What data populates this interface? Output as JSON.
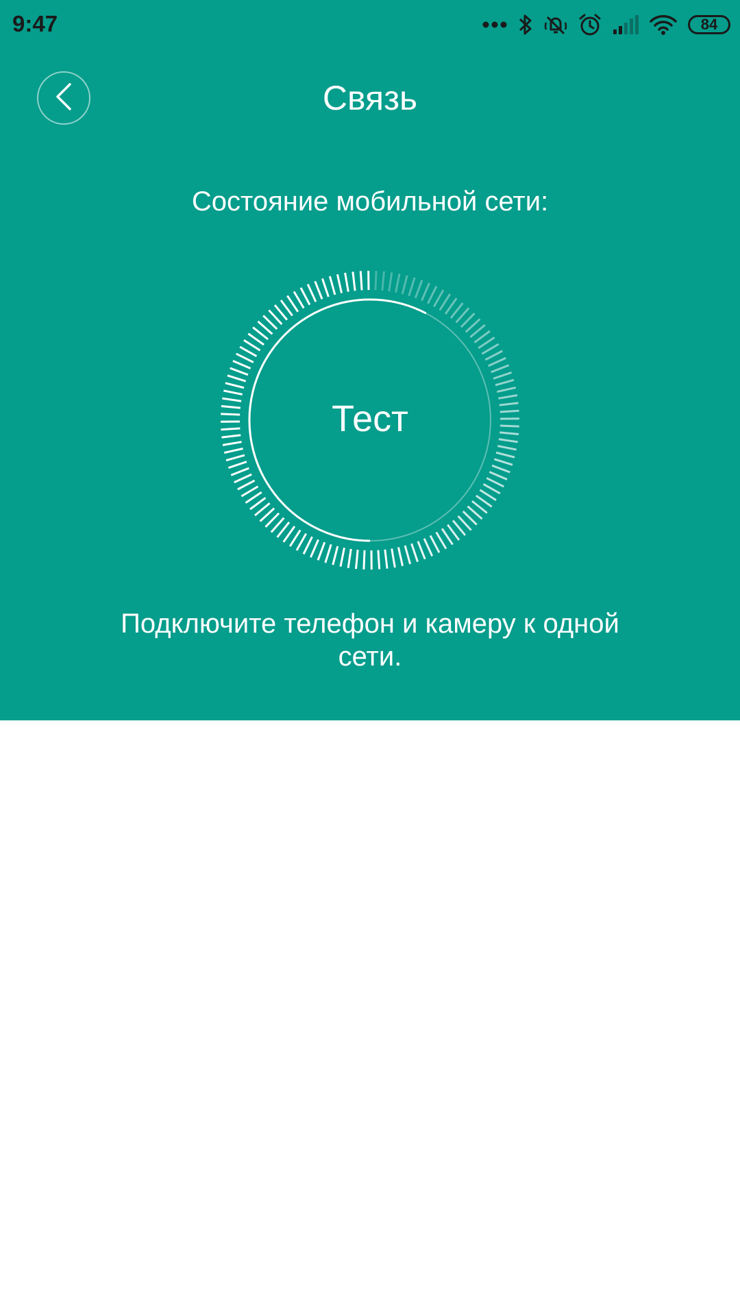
{
  "colors": {
    "accent": "#059d8c",
    "status_text": "#1a1a1a",
    "on_accent": "#ffffff",
    "background": "#ffffff"
  },
  "status_bar": {
    "time": "9:47",
    "battery": "84",
    "icons": [
      "more-dots-icon",
      "bluetooth-icon",
      "vibrate-off-icon",
      "alarm-icon",
      "cellular-signal-icon",
      "wifi-icon",
      "battery-icon"
    ]
  },
  "header": {
    "title": "Связь",
    "back_icon": "chevron-left-icon"
  },
  "main": {
    "subtitle": "Состояние мобильной сети:",
    "gauge_label": "Тест",
    "gauge_progress": 0.14,
    "instruction": "Подключите телефон и камеру к одной сети."
  }
}
